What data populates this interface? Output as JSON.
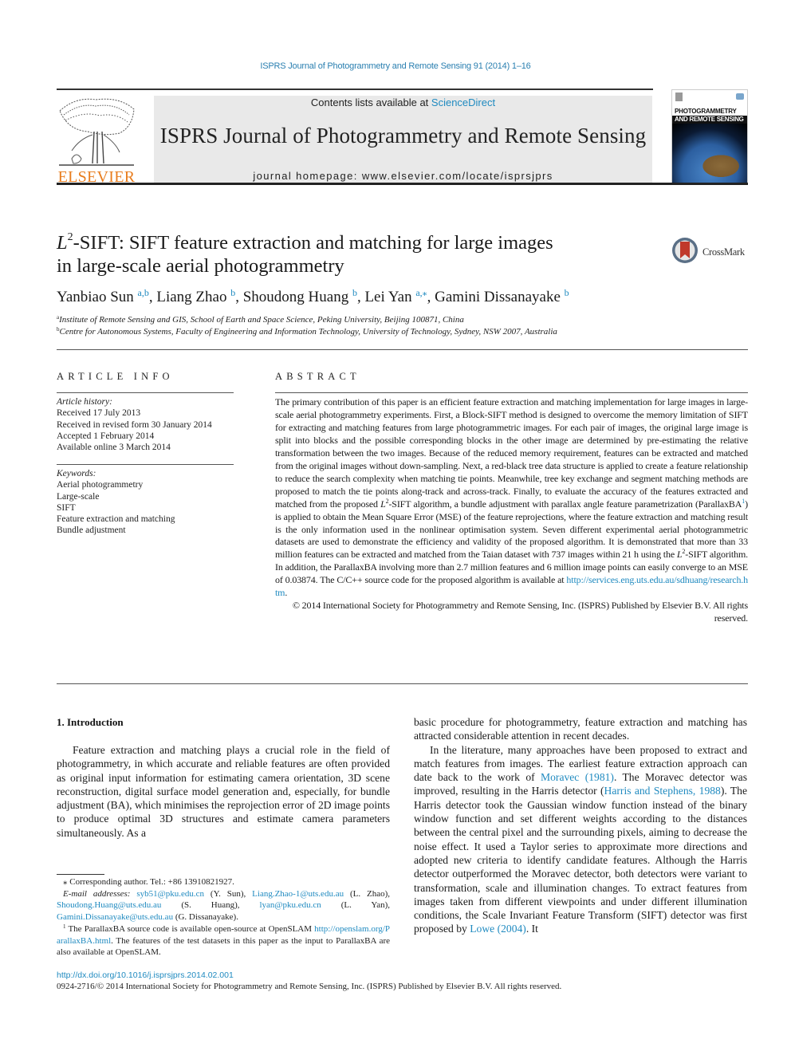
{
  "running_head": "ISPRS Journal of Photogrammetry and Remote Sensing 91 (2014) 1–16",
  "header": {
    "publisher_logo": "ELSEVIER",
    "contents_prefix": "Contents lists available at ",
    "contents_link": "ScienceDirect",
    "journal_title": "ISPRS Journal of Photogrammetry and Remote Sensing",
    "homepage": "journal homepage: www.elsevier.com/locate/isprsjprs",
    "cover": {
      "line1": "PHOTOGRAMMETRY",
      "line2": "AND REMOTE SENSING"
    }
  },
  "article": {
    "title_prefix_italic": "L",
    "title_sup": "2",
    "title_line1_rest": "-SIFT: SIFT feature extraction and matching for large images",
    "title_line2": "in large-scale aerial photogrammetry",
    "crossmark_label": "CrossMark",
    "authors": [
      {
        "name": "Yanbiao Sun",
        "aff": "a,b",
        "sep": ", "
      },
      {
        "name": "Liang Zhao",
        "aff": "b",
        "sep": ", "
      },
      {
        "name": "Shoudong Huang",
        "aff": "b",
        "sep": ", "
      },
      {
        "name": "Lei Yan",
        "aff": "a,⁎",
        "sep": ", "
      },
      {
        "name": "Gamini Dissanayake",
        "aff": "b",
        "sep": ""
      }
    ],
    "affiliations": [
      {
        "mark": "a",
        "text": "Institute of Remote Sensing and GIS, School of Earth and Space Science, Peking University, Beijing 100871, China"
      },
      {
        "mark": "b",
        "text": "Centre for Autonomous Systems, Faculty of Engineering and Information Technology, University of Technology, Sydney, NSW 2007, Australia"
      }
    ]
  },
  "article_info": {
    "heading": "ARTICLE INFO",
    "history_label": "Article history:",
    "history": [
      "Received 17 July 2013",
      "Received in revised form 30 January 2014",
      "Accepted 1 February 2014",
      "Available online 3 March 2014"
    ],
    "keywords_label": "Keywords:",
    "keywords": [
      "Aerial photogrammetry",
      "Large-scale",
      "SIFT",
      "Feature extraction and matching",
      "Bundle adjustment"
    ]
  },
  "abstract": {
    "heading": "ABSTRACT",
    "part1": "The primary contribution of this paper is an efficient feature extraction and matching implementation for large images in large-scale aerial photogrammetry experiments. First, a Block-SIFT method is designed to overcome the memory limitation of SIFT for extracting and matching features from large photogrammetric images. For each pair of images, the original large image is split into blocks and the possible corresponding blocks in the other image are determined by pre-estimating the relative transformation between the two images. Because of the reduced memory requirement, features can be extracted and matched from the original images without down-sampling. Next, a red-black tree data structure is applied to create a feature relationship to reduce the search complexity when matching tie points. Meanwhile, tree key exchange and segment matching methods are proposed to match the tie points along-track and across-track. Finally, to evaluate the accuracy of the features extracted and matched from the proposed ",
    "l2_italic": "L",
    "l2_sup": "2",
    "part2": "-SIFT algorithm, a bundle adjustment with parallax angle feature parametrization (ParallaxBA",
    "footnote_mark": "1",
    "part3": ") is applied to obtain the Mean Square Error (MSE) of the feature reprojections, where the feature extraction and matching result is the only information used in the nonlinear optimisation system. Seven different experimental aerial photogrammetric datasets are used to demonstrate the efficiency and validity of the proposed algorithm. It is demonstrated that more than 33 million features can be extracted and matched from the Taian dataset with 737 images within 21 h using the ",
    "part4": "-SIFT algorithm. In addition, the ParallaxBA involving more than 2.7 million features and 6 million image points can easily converge to an MSE of 0.03874. The C/C++ source code for the proposed algorithm is available at ",
    "code_link": "http://services.eng.uts.edu.au/sdhuang/research.htm",
    "part5": ".",
    "copyright": "© 2014 International Society for Photogrammetry and Remote Sensing, Inc. (ISPRS) Published by Elsevier B.V. All rights reserved."
  },
  "introduction": {
    "heading": "1. Introduction",
    "left_para": "Feature extraction and matching plays a crucial role in the field of photogrammetry, in which accurate and reliable features are often provided as original input information for estimating camera orientation, 3D scene reconstruction, digital surface model generation and, especially, for bundle adjustment (BA), which minimises the reprojection error of 2D image points to produce optimal 3D structures and estimate camera parameters simultaneously. As a",
    "right_para1": "basic procedure for photogrammetry, feature extraction and matching has attracted considerable attention in recent decades.",
    "right_para2_a": "In the literature, many approaches have been proposed to extract and match features from images. The earliest feature extraction approach can date back to the work of ",
    "ref_moravec": "Moravec (1981)",
    "right_para2_b": ". The Moravec detector was improved, resulting in the Harris detector (",
    "ref_harris": "Harris and Stephens, 1988",
    "right_para2_c": "). The Harris detector took the Gaussian window function instead of the binary window function and set different weights according to the distances between the central pixel and the surrounding pixels, aiming to decrease the noise effect. It used a Taylor series to approximate more directions and adopted new criteria to identify candidate features. Although the Harris detector outperformed the Moravec detector, both detectors were variant to transformation, scale and illumination changes. To extract features from images taken from different viewpoints and under different illumination conditions, the Scale Invariant Feature Transform (SIFT) detector was first proposed by ",
    "ref_lowe": "Lowe (2004)",
    "right_para2_d": ". It"
  },
  "footnotes": {
    "corresponding": "⁎ Corresponding author. Tel.: +86 13910821927.",
    "email_label": "E-mail addresses: ",
    "emails": [
      {
        "addr": "syb51@pku.edu.cn",
        "who": " (Y. Sun), "
      },
      {
        "addr": "Liang.Zhao-1@uts.edu.au",
        "who": " (L. Zhao), "
      },
      {
        "addr": "Shoudong.Huang@uts.edu.au",
        "who": " (S. Huang), "
      },
      {
        "addr": "lyan@pku.edu.cn",
        "who": " (L. Yan), "
      },
      {
        "addr": "Gamini.Dissanayake@uts.edu.au",
        "who": " (G. Dissanayake)."
      }
    ],
    "fn1_mark": "1",
    "fn1_a": " The ParallaxBA source code is available open-source at OpenSLAM ",
    "fn1_link": "http://openslam.org/ParallaxBA.html",
    "fn1_b": ". The features of the test datasets in this paper as the input to ParallaxBA are also available at OpenSLAM."
  },
  "footer": {
    "doi": "http://dx.doi.org/10.1016/j.isprsjprs.2014.02.001",
    "issn": "0924-2716/© 2014 International Society for Photogrammetry and Remote Sensing, Inc. (ISPRS) Published by Elsevier B.V. All rights reserved."
  }
}
